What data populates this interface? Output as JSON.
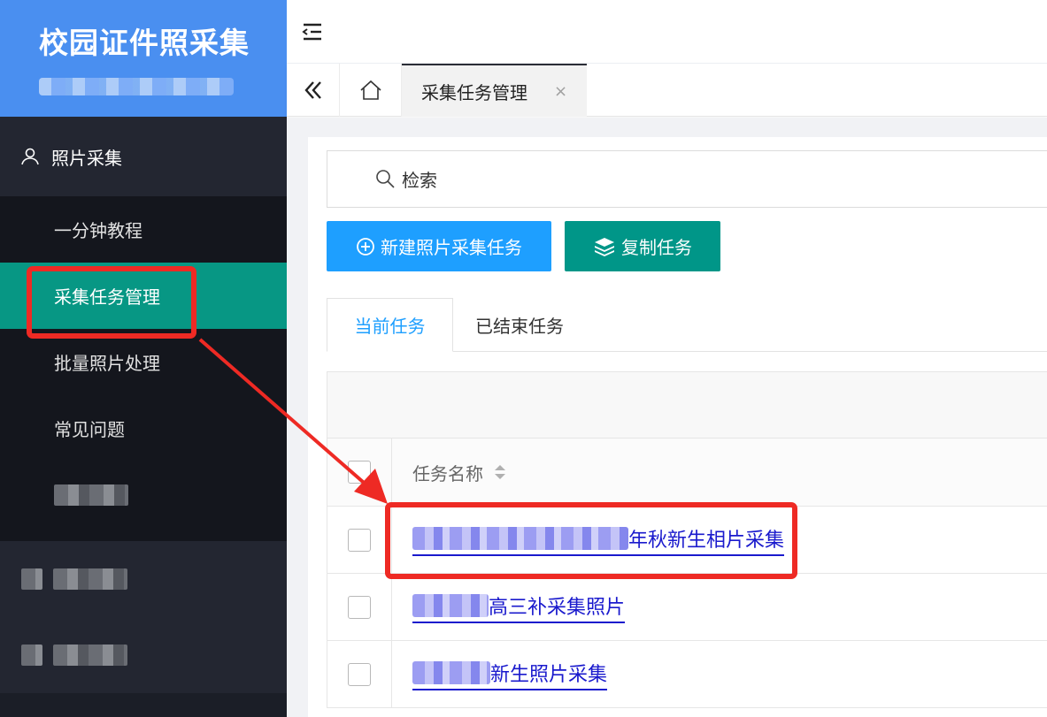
{
  "app": {
    "title": "校园证件照采集"
  },
  "sidebar": {
    "group": {
      "label": "照片采集",
      "icon": "user-icon"
    },
    "items": [
      {
        "label": "一分钟教程"
      },
      {
        "label": "采集任务管理",
        "active": true
      },
      {
        "label": "批量照片处理"
      },
      {
        "label": "常见问题"
      }
    ]
  },
  "tabbar": {
    "open_tab": {
      "label": "采集任务管理",
      "close": "×"
    }
  },
  "search": {
    "label": "检索"
  },
  "toolbar": {
    "new_task_label": "新建照片采集任务",
    "copy_task_label": "复制任务"
  },
  "task_tabs": [
    {
      "label": "当前任务",
      "active": true
    },
    {
      "label": "已结束任务",
      "active": false
    }
  ],
  "table": {
    "columns": [
      {
        "label": "任务名称",
        "sortable": true
      }
    ],
    "rows": [
      {
        "name_visible": "年秋新生相片采集"
      },
      {
        "name_visible": "高三补采集照片"
      },
      {
        "name_visible": "新生照片采集"
      }
    ]
  },
  "colors": {
    "brand": "#4a8ff0",
    "sidebar": "#1b1e27",
    "active": "#079784",
    "primary_button": "#1e9fff",
    "teal_button": "#009688",
    "annotation": "#ee2a24",
    "link": "#1a1acd"
  }
}
